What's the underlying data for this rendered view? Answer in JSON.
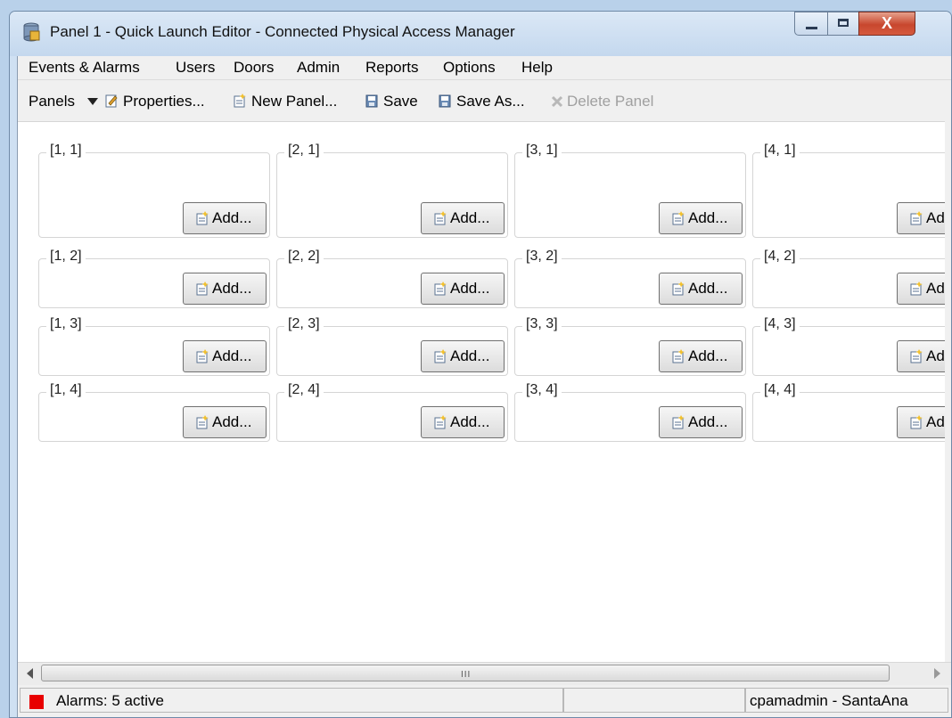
{
  "window": {
    "title": "Panel 1 - Quick Launch Editor - Connected Physical Access Manager",
    "close_glyph": "X"
  },
  "menu": [
    "Events & Alarms",
    "Users",
    "Doors",
    "Admin",
    "Reports",
    "Options",
    "Help"
  ],
  "toolbar": {
    "panels_label": "Panels",
    "properties_label": "Properties...",
    "new_panel_label": "New Panel...",
    "save_label": "Save",
    "save_as_label": "Save As...",
    "delete_panel_label": "Delete Panel",
    "delete_disabled": true
  },
  "grid": {
    "columns": 4,
    "rows": 4,
    "cells": [
      {
        "label": "[1, 1]",
        "add_label": "Add..."
      },
      {
        "label": "[2, 1]",
        "add_label": "Add..."
      },
      {
        "label": "[3, 1]",
        "add_label": "Add..."
      },
      {
        "label": "[4, 1]",
        "add_label": "Add..."
      },
      {
        "label": "[1, 2]",
        "add_label": "Add..."
      },
      {
        "label": "[2, 2]",
        "add_label": "Add..."
      },
      {
        "label": "[3, 2]",
        "add_label": "Add..."
      },
      {
        "label": "[4, 2]",
        "add_label": "Add..."
      },
      {
        "label": "[1, 3]",
        "add_label": "Add..."
      },
      {
        "label": "[2, 3]",
        "add_label": "Add..."
      },
      {
        "label": "[3, 3]",
        "add_label": "Add..."
      },
      {
        "label": "[4, 3]",
        "add_label": "Add..."
      },
      {
        "label": "[1, 4]",
        "add_label": "Add..."
      },
      {
        "label": "[2, 4]",
        "add_label": "Add..."
      },
      {
        "label": "[3, 4]",
        "add_label": "Add..."
      },
      {
        "label": "[4, 4]",
        "add_label": "Add..."
      }
    ]
  },
  "scrollbar": {
    "grip": "III"
  },
  "status": {
    "alarm_color": "#e80000",
    "alarms_text": "Alarms: 5 active",
    "user_text": "cpamadmin - SantaAna"
  },
  "colors": {
    "close_button": "#c8472e",
    "titlebar": "#c4d8ee"
  }
}
